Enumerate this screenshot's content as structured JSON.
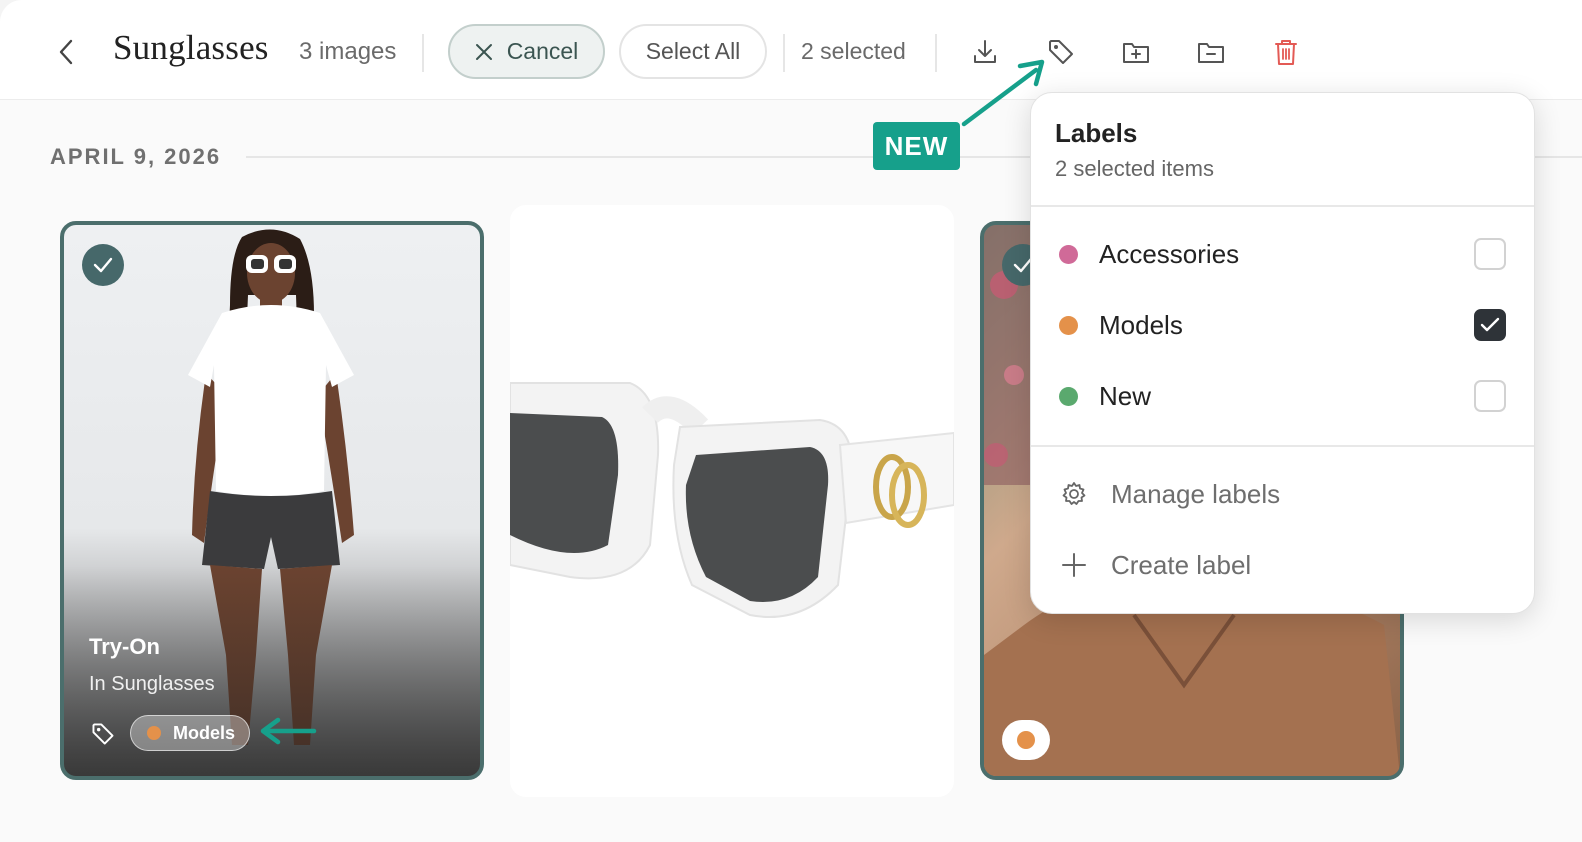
{
  "header": {
    "title": "Sunglasses",
    "count": "3 images",
    "cancel_label": "Cancel",
    "select_all_label": "Select All",
    "selected_count": "2 selected"
  },
  "toolbar": {
    "icons": [
      "download-icon",
      "tag-icon",
      "folder-add-icon",
      "folder-remove-icon",
      "trash-icon"
    ],
    "danger_color": "#e35a55"
  },
  "section": {
    "date": "APRIL 9, 2026"
  },
  "annotation": {
    "new_badge": "NEW",
    "color": "#16a08b"
  },
  "cards": [
    {
      "selected": true,
      "title": "Try-On",
      "subtitle": "In Sunglasses",
      "label": "Models",
      "label_color": "#e4914a"
    },
    {
      "selected": false
    },
    {
      "selected": true,
      "label_color": "#e4914a"
    }
  ],
  "labels_menu": {
    "title": "Labels",
    "subtitle": "2 selected items",
    "items": [
      {
        "name": "Accessories",
        "color": "#d06a98",
        "checked": false
      },
      {
        "name": "Models",
        "color": "#e4914a",
        "checked": true
      },
      {
        "name": "New",
        "color": "#5aa96e",
        "checked": false
      }
    ],
    "actions": [
      {
        "name": "Manage labels",
        "icon": "gear-icon"
      },
      {
        "name": "Create label",
        "icon": "plus-icon"
      }
    ]
  }
}
